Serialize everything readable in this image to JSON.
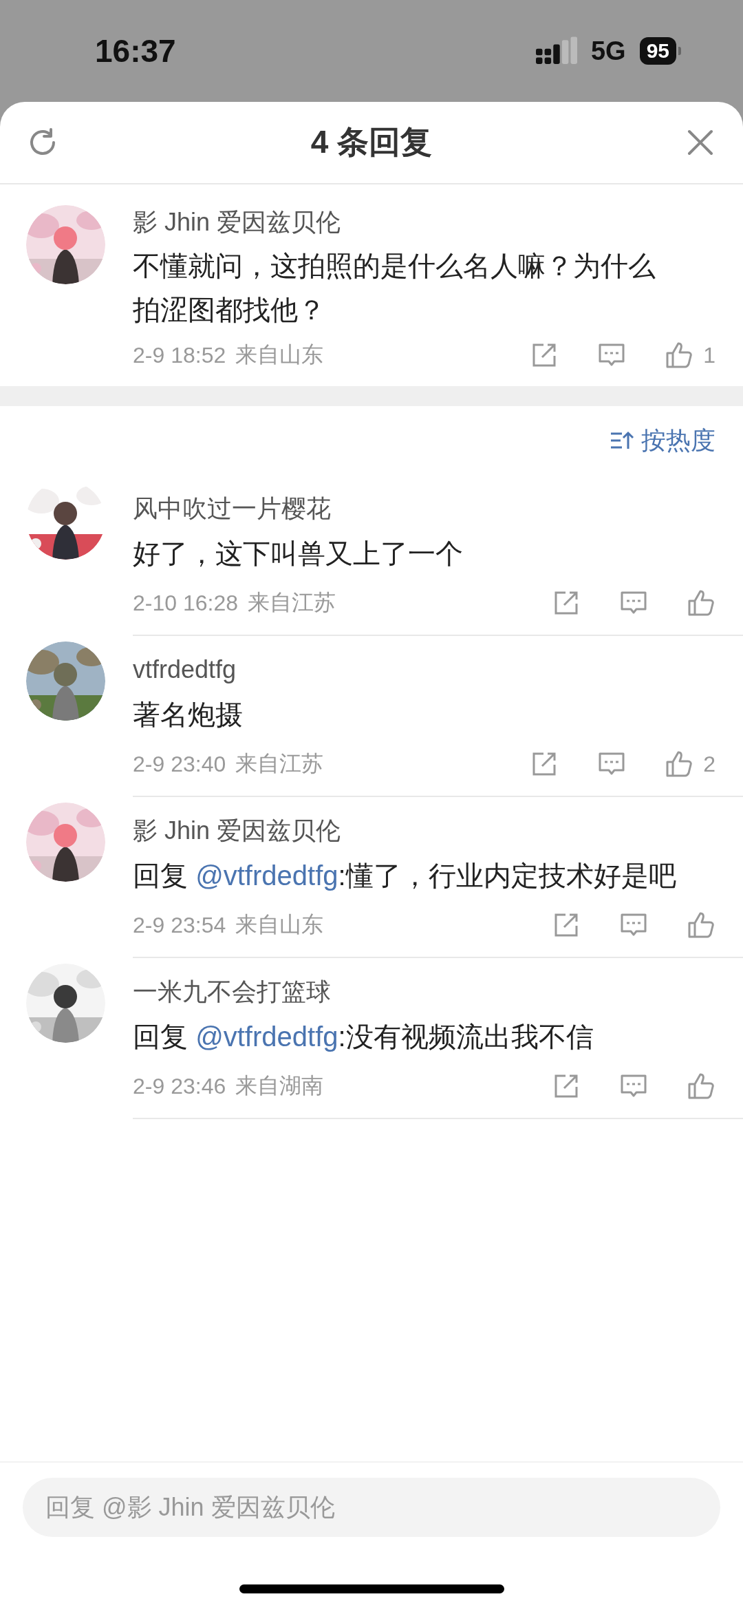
{
  "status_bar": {
    "time": "16:37",
    "network": "5G",
    "battery": "95"
  },
  "sheet": {
    "title": "4 条回复"
  },
  "root_comment": {
    "author": "影 Jhin 爱因兹贝伦",
    "text": "不懂就问，这拍照的是什么名人嘛？为什么拍涩图都找他？",
    "time": "2-9 18:52",
    "location": "来自山东",
    "like_count": "1"
  },
  "sort": {
    "label": "按热度"
  },
  "replies": [
    {
      "author": "风中吹过一片樱花",
      "text": "好了，这下叫兽又上了一个",
      "time": "2-10 16:28",
      "location": "来自江苏"
    },
    {
      "author": "vtfrdedtfg",
      "text": "著名炮摄",
      "time": "2-9 23:40",
      "location": "来自江苏",
      "like_count": "2"
    },
    {
      "author": "影 Jhin 爱因兹贝伦",
      "reply_prefix": "回复",
      "mention": "@vtfrdedtfg",
      "text": ":懂了，行业内定技术好是吧",
      "time": "2-9 23:54",
      "location": "来自山东"
    },
    {
      "author": "一米九不会打篮球",
      "reply_prefix": "回复",
      "mention": "@vtfrdedtfg",
      "text": ":没有视频流出我不信",
      "time": "2-9 23:46",
      "location": "来自湖南"
    }
  ],
  "reply_field": {
    "placeholder": "回复 @影 Jhin 爱因兹贝伦"
  }
}
